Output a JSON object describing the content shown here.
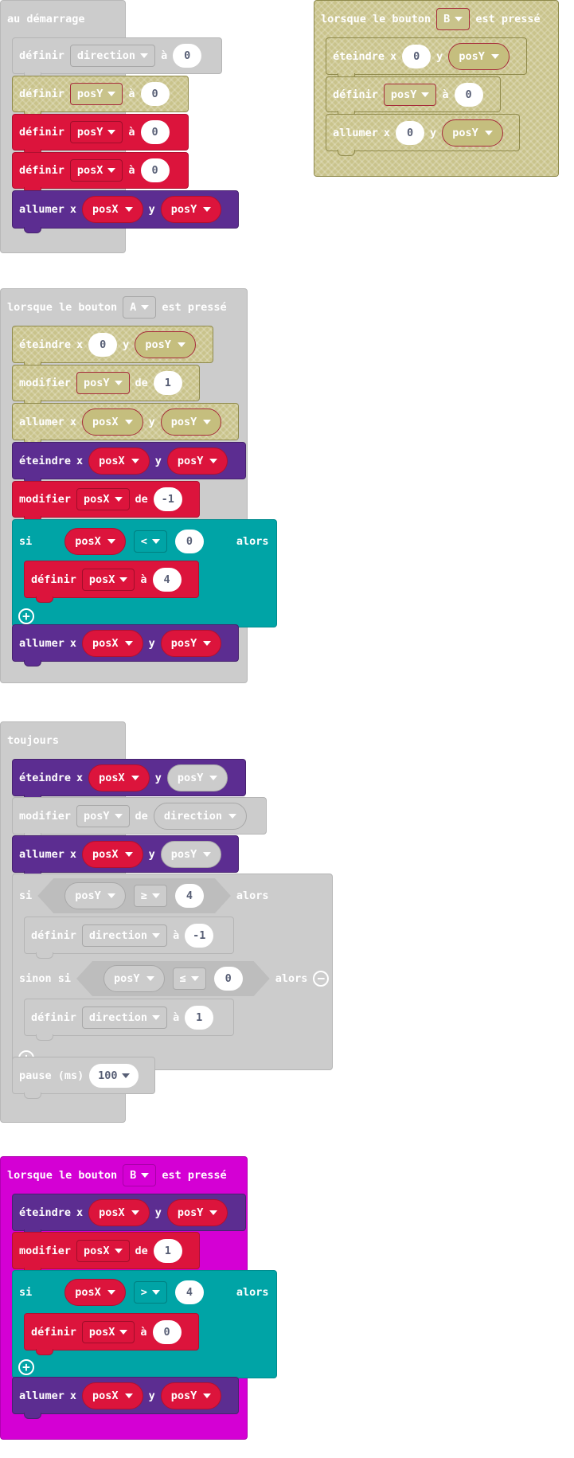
{
  "kw": {
    "on_start": "au démarrage",
    "forever": "toujours",
    "on_button": "lorsque le bouton",
    "pressed": "est pressé",
    "set": "définir",
    "change": "modifier",
    "to": "à",
    "by": "de",
    "plot": "allumer",
    "unplot": "éteindre",
    "x": "x",
    "y": "y",
    "if": "si",
    "then": "alors",
    "else_if": "sinon si",
    "pause": "pause (ms)"
  },
  "vars": {
    "direction": "direction",
    "posX": "posX",
    "posY": "posY"
  },
  "buttons": {
    "a": "A",
    "b": "B"
  },
  "ops": {
    "lt": "<",
    "gt": ">",
    "ge": "≥",
    "le": "≤"
  },
  "nums": {
    "zero": "0",
    "one": "1",
    "minus_one": "-1",
    "four": "4",
    "hundred": "100"
  },
  "icons": {
    "add": "plus-circle-icon",
    "remove": "minus-circle-icon",
    "dropdown": "caret-down-icon"
  },
  "colors": {
    "variables": "#dc143c",
    "led": "#5c2d91",
    "logic": "#00a4a6",
    "event_disabled": "#cccccc",
    "event_highlight": "#d400d4",
    "olive_pattern": "#c9c38b"
  }
}
